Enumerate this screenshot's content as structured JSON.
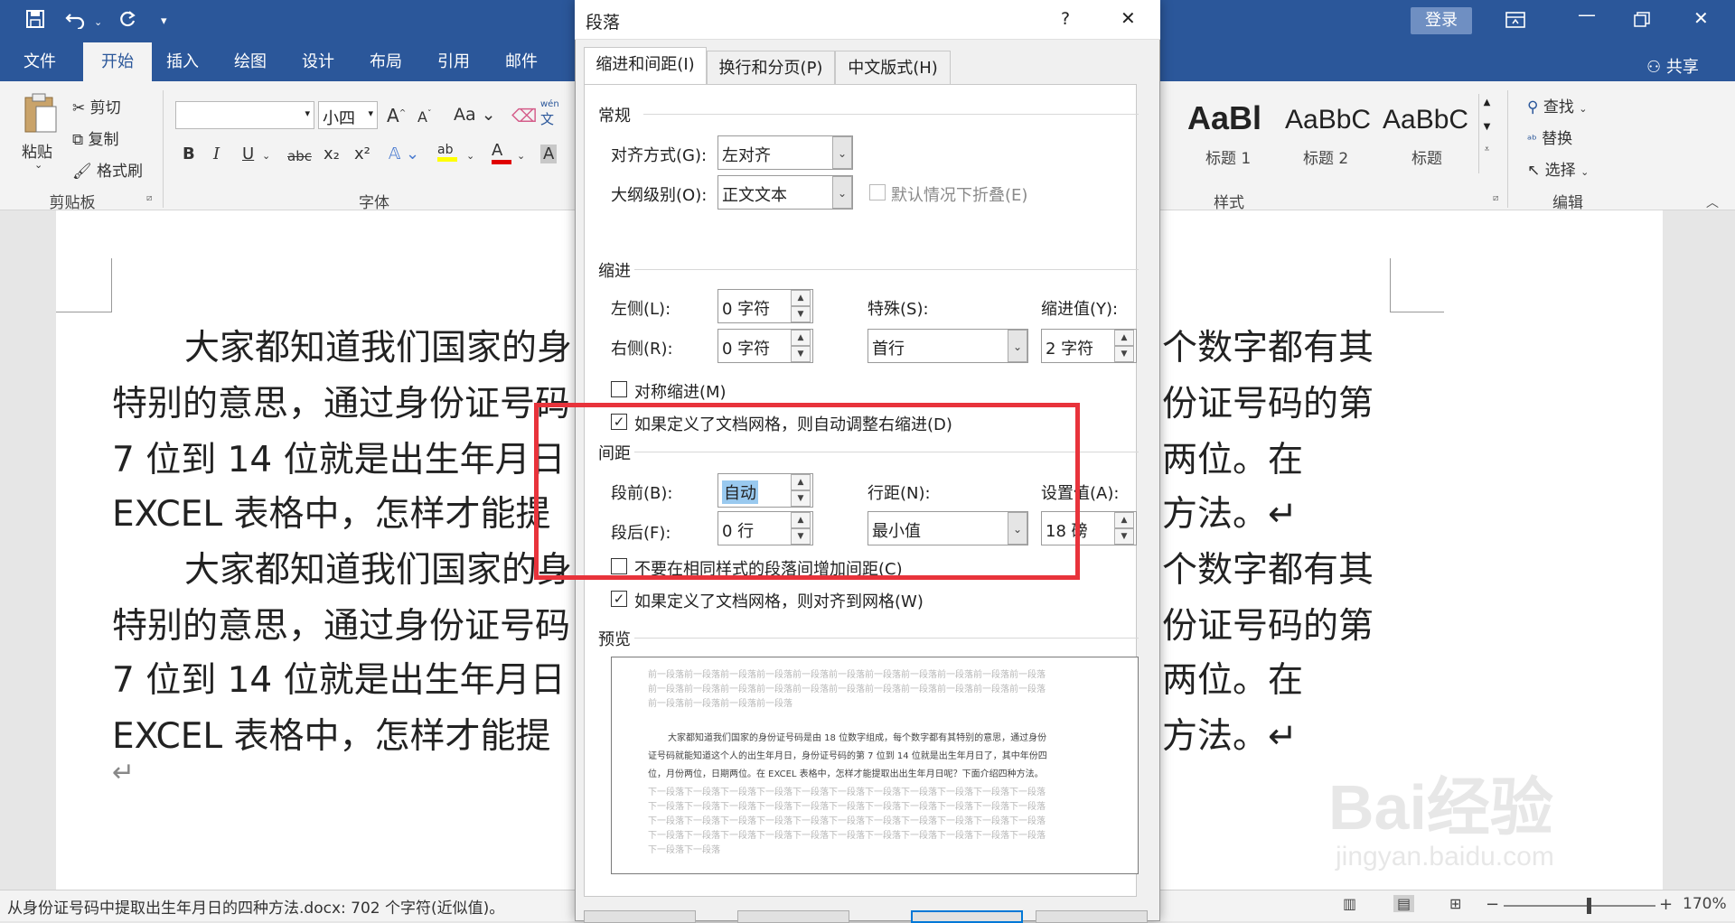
{
  "app": {
    "login_label": "登录",
    "share_label": "共享"
  },
  "tabs": [
    "文件",
    "开始",
    "插入",
    "绘图",
    "设计",
    "布局",
    "引用",
    "邮件"
  ],
  "ribbon": {
    "clipboard": {
      "paste": "粘贴",
      "cut": "剪切",
      "copy": "复制",
      "format_painter": "格式刷",
      "group": "剪贴板"
    },
    "font": {
      "font_name": "",
      "font_size": "小四",
      "group": "字体",
      "grow": "A",
      "shrink": "A",
      "case": "Aa",
      "bold": "B",
      "italic": "I",
      "underline": "U",
      "strike": "abc",
      "sub": "x₂",
      "sup": "x²",
      "highlight": "ab",
      "color": "A",
      "shade": "A",
      "phonetic": "wén"
    },
    "styles": {
      "group": "样式",
      "items": [
        {
          "sample": "AaBl",
          "name": "标题 1"
        },
        {
          "sample": "AaBbC",
          "name": "标题 2"
        },
        {
          "sample": "AaBbC",
          "name": "标题"
        }
      ]
    },
    "editing": {
      "find": "查找",
      "replace": "替换",
      "select": "选择",
      "group": "编辑"
    }
  },
  "document": {
    "lines": [
      "大家都知道我们国家的身",
      "特别的意思，通过身份证号码",
      "7 位到 14 位就是出生年月日",
      "EXCEL 表格中，怎样才能提",
      "大家都知道我们国家的身",
      "特别的意思，通过身份证号码",
      "7 位到 14 位就是出生年月日",
      "EXCEL 表格中，怎样才能提"
    ],
    "right_lines": [
      "个数字都有其",
      "份证号码的第",
      "两位。在",
      "方法。↵",
      "个数字都有其",
      "份证号码的第",
      "两位。在",
      "方法。↵"
    ],
    "para_mark": "↵"
  },
  "status": {
    "text": "从身份证号码中提取出生年月日的四种方法.docx: 702 个字符(近似值)。",
    "zoom": "170%"
  },
  "dialog": {
    "title": "段落",
    "help": "?",
    "close": "✕",
    "tabs": [
      "缩进和间距(I)",
      "换行和分页(P)",
      "中文版式(H)"
    ],
    "general": {
      "section": "常规",
      "alignment_label": "对齐方式(G):",
      "alignment_value": "左对齐",
      "outline_label": "大纲级别(O):",
      "outline_value": "正文文本",
      "collapse_label": "默认情况下折叠(E)"
    },
    "indent": {
      "section": "缩进",
      "left_label": "左侧(L):",
      "left_value": "0 字符",
      "right_label": "右侧(R):",
      "right_value": "0 字符",
      "special_label": "特殊(S):",
      "special_value": "首行",
      "by_label": "缩进值(Y):",
      "by_value": "2 字符",
      "mirror_label": "对称缩进(M)",
      "auto_adjust_label": "如果定义了文档网格，则自动调整右缩进(D)"
    },
    "spacing": {
      "section": "间距",
      "before_label": "段前(B):",
      "before_value": "自动",
      "after_label": "段后(F):",
      "after_value": "0 行",
      "line_label": "行距(N):",
      "line_value": "最小值",
      "at_label": "设置值(A):",
      "at_value": "18 磅",
      "no_space_label": "不要在相同样式的段落间增加间距(C)",
      "snap_grid_label": "如果定义了文档网格，则对齐到网格(W)"
    },
    "preview": {
      "section": "预览",
      "prev_lines": [
        "前一段落前一段落前一段落前一段落前一段落前一段落前一段落前一段落前一段落前一段落前一段落",
        "前一段落前一段落前一段落前一段落前一段落前一段落前一段落前一段落前一段落前一段落前一段落",
        "前一段落前一段落前一段落前一段落"
      ],
      "body_lines": [
        "大家都知道我们国家的身份证号码是由 18 位数字组成，每个数字都有其特别的意思，通过身份",
        "证号码就能知道这个人的出生年月日，身份证号码的第 7 位到 14 位就是出生年月日了，其中年份四",
        "位，月份两位，日期两位。在 EXCEL 表格中，怎样才能提取出出生年月日呢？下面介绍四种方法。"
      ],
      "next_lines": [
        "下一段落下一段落下一段落下一段落下一段落下一段落下一段落下一段落下一段落下一段落下一段落",
        "下一段落下一段落下一段落下一段落下一段落下一段落下一段落下一段落下一段落下一段落下一段落",
        "下一段落下一段落下一段落下一段落下一段落下一段落下一段落下一段落下一段落下一段落下一段落",
        "下一段落下一段落下一段落下一段落下一段落下一段落下一段落下一段落下一段落下一段落下一段落",
        "下一段落下一段落"
      ]
    }
  },
  "watermark": {
    "brand": "Bai经验",
    "url": "jingyan.baidu.com"
  },
  "colors": {
    "ribbon_blue": "#2b579a",
    "highlight_red": "#e8333b",
    "selection": "#99c9ef"
  }
}
